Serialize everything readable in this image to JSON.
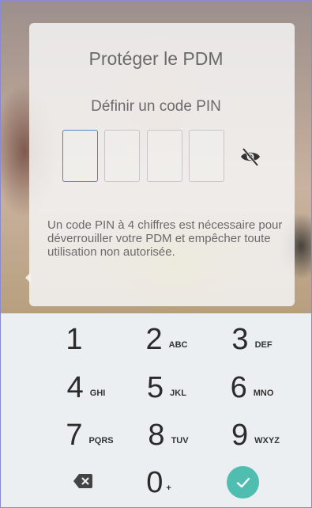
{
  "dialog": {
    "title": "Protéger le PDM",
    "subtitle": "Définir un code PIN",
    "pin_digits": [
      "",
      "",
      "",
      ""
    ],
    "info": "Un code PIN à 4 chiffres est nécessaire pour déverrouiller votre PDM et empêcher toute utilisation non autorisée.",
    "visibility_icon": "eye-off-icon"
  },
  "keypad": {
    "keys": [
      {
        "digit": "1",
        "letters": ""
      },
      {
        "digit": "2",
        "letters": "ABC"
      },
      {
        "digit": "3",
        "letters": "DEF"
      },
      {
        "digit": "4",
        "letters": "GHI"
      },
      {
        "digit": "5",
        "letters": "JKL"
      },
      {
        "digit": "6",
        "letters": "MNO"
      },
      {
        "digit": "7",
        "letters": "PQRS"
      },
      {
        "digit": "8",
        "letters": "TUV"
      },
      {
        "digit": "9",
        "letters": "WXYZ"
      },
      {
        "digit": "0",
        "letters": "+"
      }
    ],
    "backspace_icon": "backspace-icon",
    "confirm_icon": "check-icon",
    "accent_color": "#4fbeb1"
  }
}
